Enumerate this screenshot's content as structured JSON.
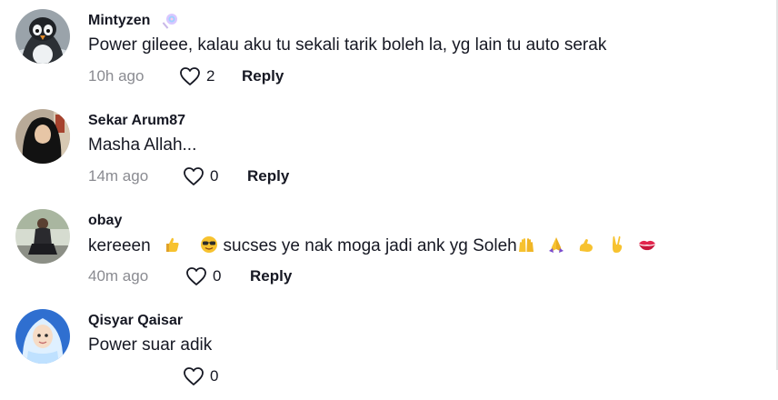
{
  "comments": [
    {
      "username": "Mintyzen",
      "badge_icon": "lollipop-icon",
      "text": "Power gileee, kalau aku tu sekali tarik boleh la, yg lain tu auto serak",
      "time": "10h ago",
      "likes": "2",
      "reply": "Reply",
      "avatar": "penguin-avatar"
    },
    {
      "username": "Sekar Arum87",
      "text": "Masha Allah...",
      "time": "14m ago",
      "likes": "0",
      "reply": "Reply",
      "avatar": "hijab-woman-avatar"
    },
    {
      "username": "obay",
      "text_start": "kereeen",
      "text_middle": "sucses ye nak moga jadi ank yg Soleh",
      "emojis": [
        "thumbs-up-icon",
        "smiling-face-with-sunglasses-icon",
        "raising-hands-icon",
        "folded-hands-icon",
        "flexed-biceps-icon",
        "victory-hand-icon",
        "kiss-mark-icon"
      ],
      "time": "40m ago",
      "likes": "0",
      "reply": "Reply",
      "avatar": "sitting-person-avatar"
    },
    {
      "username": "Qisyar Qaisar",
      "text": "Power suar adik",
      "likes": "0",
      "avatar": "cartoon-hijab-avatar"
    }
  ],
  "colors": {
    "text": "#161823",
    "muted": "#8a8b91",
    "emoji_yellow": "#f7c22f",
    "kiss_red": "#e2264d"
  }
}
